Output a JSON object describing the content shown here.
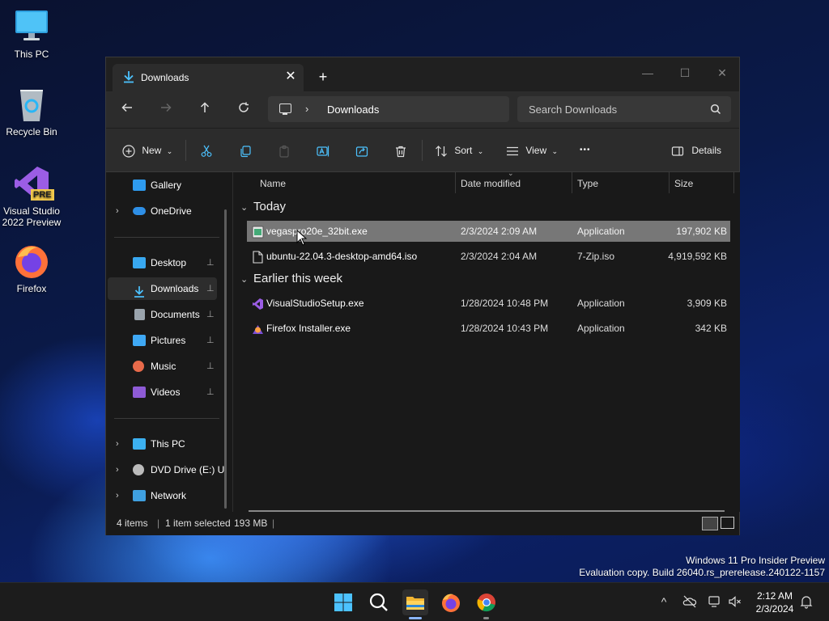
{
  "desktop": {
    "icons": [
      {
        "label": "This PC",
        "icon": "this-pc-icon"
      },
      {
        "label": "Recycle Bin",
        "icon": "recycle-bin-icon"
      },
      {
        "label": "Visual Studio 2022 Preview",
        "badge": "PRE",
        "icon": "visual-studio-icon"
      },
      {
        "label": "Firefox",
        "icon": "firefox-icon"
      }
    ],
    "watermark": {
      "line1": "Windows 11 Pro Insider Preview",
      "line2": "Evaluation copy. Build 26040.rs_prerelease.240122-1157"
    }
  },
  "window": {
    "tab_title": "Downloads",
    "new_tab": "+",
    "tab_close": "✕",
    "controls": {
      "minimize": "—",
      "maximize": "☐",
      "close": "✕"
    },
    "address": {
      "chevron": "›",
      "path": "Downloads"
    },
    "search": {
      "placeholder": "Search Downloads"
    },
    "commands": {
      "new": "New",
      "sort": "Sort",
      "view": "View",
      "more": "•••",
      "details": "Details"
    },
    "sidebar": {
      "items": [
        {
          "label": "Gallery"
        },
        {
          "label": "OneDrive"
        },
        {
          "label": "Desktop"
        },
        {
          "label": "Downloads"
        },
        {
          "label": "Documents"
        },
        {
          "label": "Pictures"
        },
        {
          "label": "Music"
        },
        {
          "label": "Videos"
        },
        {
          "label": "This PC"
        },
        {
          "label": "DVD Drive (E:) U"
        },
        {
          "label": "Network"
        }
      ],
      "expander": "›",
      "pin": "📌"
    },
    "columns": {
      "name": "Name",
      "date": "Date modified",
      "type": "Type",
      "size": "Size"
    },
    "groups": {
      "today": "Today",
      "earlier": "Earlier this week"
    },
    "files": [
      {
        "name": "vegaspro20e_32bit.exe",
        "date": "2/3/2024 2:09 AM",
        "type": "Application",
        "size": "197,902 KB"
      },
      {
        "name": "ubuntu-22.04.3-desktop-amd64.iso",
        "date": "2/3/2024 2:04 AM",
        "type": "7-Zip.iso",
        "size": "4,919,592 KB"
      },
      {
        "name": "VisualStudioSetup.exe",
        "date": "1/28/2024 10:48 PM",
        "type": "Application",
        "size": "3,909 KB"
      },
      {
        "name": "Firefox Installer.exe",
        "date": "1/28/2024 10:43 PM",
        "type": "Application",
        "size": "342 KB"
      }
    ],
    "status": {
      "count": "4 items",
      "selected": "1 item selected",
      "size": "193 MB"
    }
  },
  "taskbar": {
    "clock": {
      "time": "2:12 AM",
      "date": "2/3/2024"
    },
    "tray_chevron": "^"
  },
  "colors": {
    "accent": "#4cc2ff",
    "selection": "#777777",
    "window_bg": "#191919"
  }
}
